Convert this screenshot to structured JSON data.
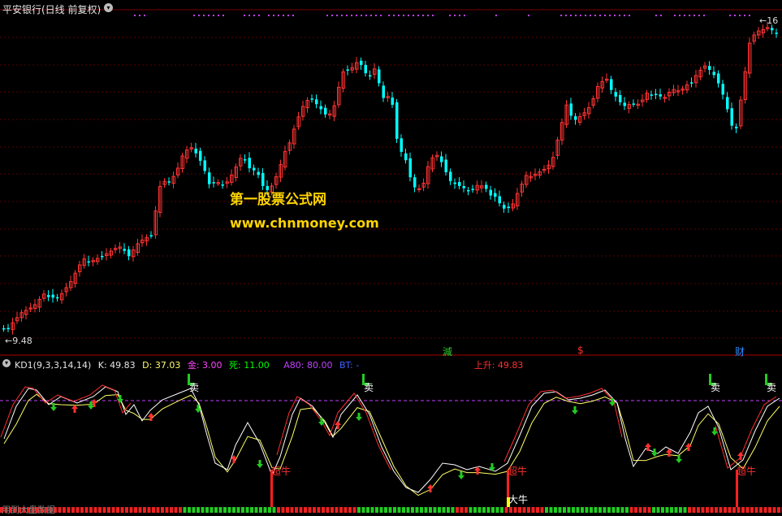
{
  "window": {
    "title": "平安银行(日线 前复权)",
    "menu_icon": "chevron-down-icon"
  },
  "price_chart": {
    "low_marker": "9.48",
    "high_marker": "16",
    "event_markers": [
      {
        "text": "減",
        "color": "#2bd12b"
      },
      {
        "text": "$",
        "color": "#ff3030"
      },
      {
        "text": "财",
        "color": "#2a8cff"
      }
    ],
    "up_color": "#ff3232",
    "down_color": "#00ffff"
  },
  "watermark": {
    "line1": "第一股票公式网",
    "line2": "www.chnmoney.com",
    "color": "#ffd400"
  },
  "indicator": {
    "name": "KD1(9,3,3,14,14)",
    "k_label": "K: 49.83",
    "d_label": "D: 37.03",
    "gold_label": "金: 3.00",
    "death_label": "死: 11.00",
    "a80_label": "A80: 80.00",
    "bt_label": "BT: -",
    "trend_label": "上升: 49.83",
    "colors": {
      "k": "#ffffff",
      "d": "#ffff66",
      "gold": "#ff44ff",
      "death": "#00ff00",
      "a80": "#c040ff",
      "bt": "#4060ff",
      "trend": "#ff3030"
    },
    "sell_label": "卖",
    "super_bull_label": "超牛",
    "big_bull_label": "大牛"
  },
  "footer": {
    "partial_text": "用到大盘数据"
  }
}
